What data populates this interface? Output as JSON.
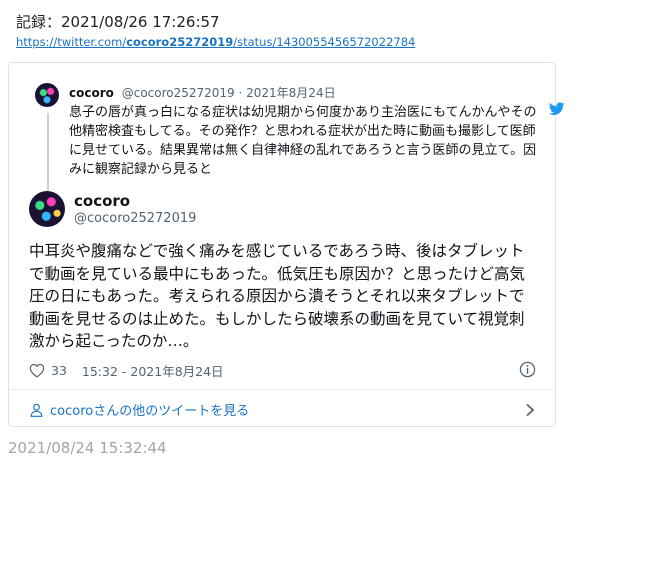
{
  "record": {
    "title": "記録：2021/08/26 17:26:57"
  },
  "source_link": {
    "prefix": "https://twitter.com/",
    "user": "cocoro25272019",
    "suffix": "/status/1430055456572022784"
  },
  "quoted_tweet": {
    "name": "cocoro",
    "meta": "@cocoro25272019 · 2021年8月24日",
    "text": "息子の唇が真っ白になる症状は幼児期から何度かあり主治医にもてんかんやその他精密検査もしてる。その発作？と思われる症状が出た時に動画も撮影して医師に見せている。結果異常は無く自律神経の乱れであろうと言う医師の見立て。因みに観察記録から見ると",
    "icon": "twitter-bird-icon"
  },
  "main_tweet": {
    "name": "cocoro",
    "handle": "@cocoro25272019",
    "text": "中耳炎や腹痛などで強く痛みを感じているであろう時、後はタブレットで動画を見ている最中にもあった。低気圧も原因か？と思ったけど高気圧の日にもあった。考えられる原因から潰そうとそれ以来タブレットで動画を見せるのは止めた。もしかしたら破壊系の動画を見ていて視覚刺激から起こったのか…。",
    "likes": "33",
    "time": "15:32 - 2021年8月24日",
    "more_label": "cocoroさんの他のツイートを見る"
  },
  "footer": {
    "timestamp": "2021/08/24 15:32:44"
  },
  "colors": {
    "link": "#1a73c4",
    "twitter_blue": "#1d9bf0",
    "muted": "#536471"
  }
}
